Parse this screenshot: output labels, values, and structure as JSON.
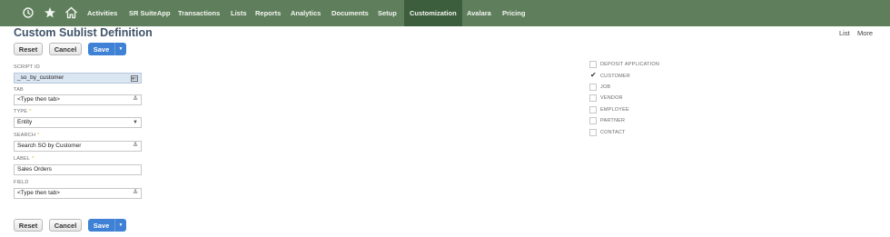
{
  "nav": {
    "icons": [
      "recent-icon",
      "star-icon",
      "home-icon"
    ],
    "items": [
      {
        "label": "Activities"
      },
      {
        "label": "SR SuiteApp"
      },
      {
        "label": "Transactions"
      },
      {
        "label": "Lists"
      },
      {
        "label": "Reports"
      },
      {
        "label": "Analytics"
      },
      {
        "label": "Documents"
      },
      {
        "label": "Setup"
      },
      {
        "label": "Customization",
        "active": true
      },
      {
        "label": "Avalara"
      },
      {
        "label": "Pricing"
      }
    ]
  },
  "page": {
    "title": "Custom Sublist Definition",
    "links": {
      "list": "List",
      "more": "More"
    }
  },
  "buttons": {
    "reset": "Reset",
    "cancel": "Cancel",
    "save": "Save"
  },
  "form": {
    "script_id": {
      "label": "SCRIPT ID",
      "value": "_so_by_customer"
    },
    "tab": {
      "label": "TAB",
      "value": "<Type then tab>"
    },
    "type": {
      "label": "TYPE",
      "value": "Entity",
      "required": true
    },
    "search": {
      "label": "SEARCH",
      "value": "Search SO by Customer",
      "required": true
    },
    "label": {
      "label": "LABEL",
      "value": "Sales Orders",
      "required": true
    },
    "field": {
      "label": "FIELD",
      "value": "<Type then tab>"
    }
  },
  "applies_to": [
    {
      "label": "DEPOSIT APPLICATION",
      "checked": false
    },
    {
      "label": "CUSTOMER",
      "checked": true
    },
    {
      "label": "JOB",
      "checked": false
    },
    {
      "label": "VENDOR",
      "checked": false
    },
    {
      "label": "EMPLOYEE",
      "checked": false
    },
    {
      "label": "PARTNER",
      "checked": false
    },
    {
      "label": "CONTACT",
      "checked": false
    }
  ],
  "colors": {
    "navbar": "#5f7f5c",
    "nav_active": "#3d5e3c",
    "title": "#41556b",
    "save_button": "#3f81d4",
    "required_star": "#e3b41a"
  }
}
